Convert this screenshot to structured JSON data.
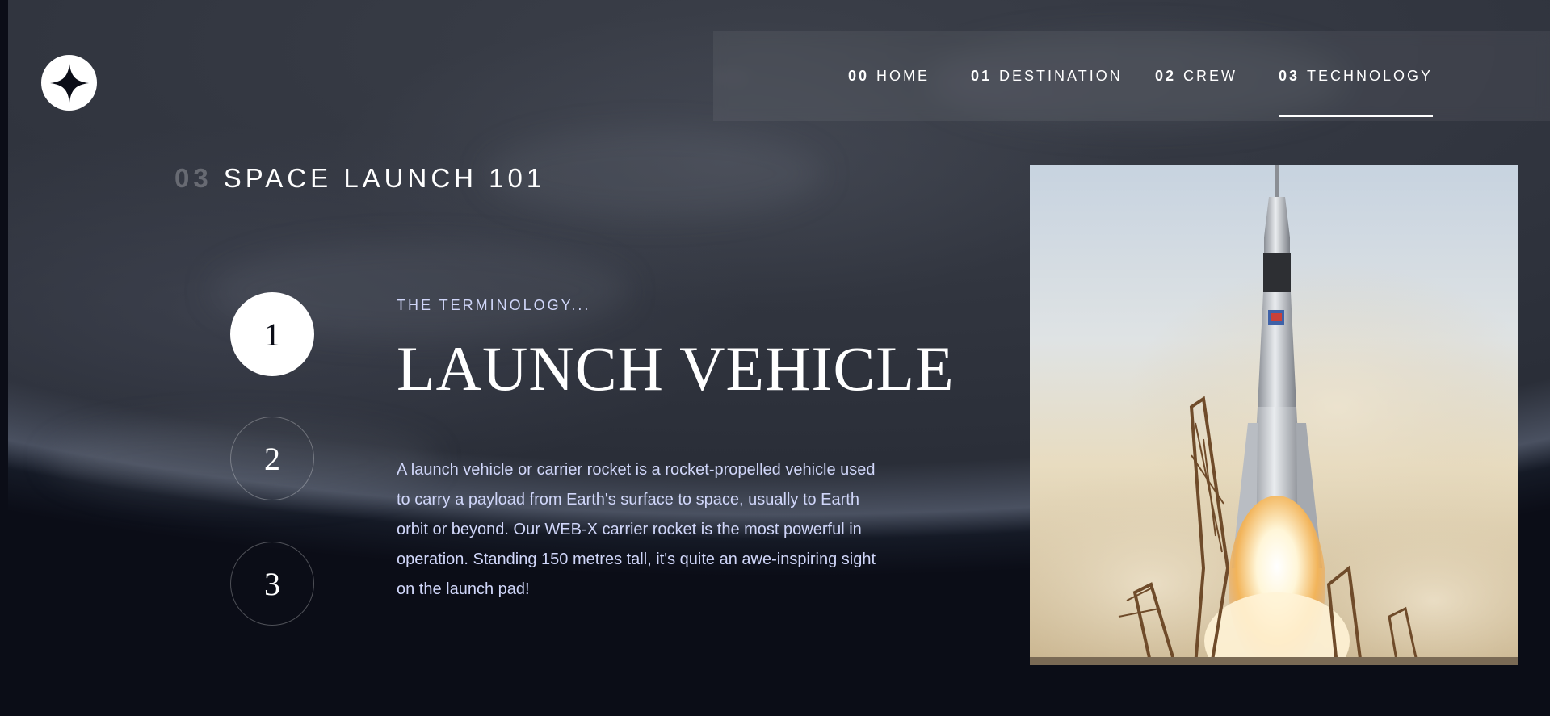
{
  "logo": {
    "icon": "star-logo-icon"
  },
  "nav": {
    "items": [
      {
        "num": "00",
        "label": "HOME",
        "active": false
      },
      {
        "num": "01",
        "label": "DESTINATION",
        "active": false
      },
      {
        "num": "02",
        "label": "CREW",
        "active": false
      },
      {
        "num": "03",
        "label": "TECHNOLOGY",
        "active": true
      }
    ]
  },
  "heading": {
    "num": "03",
    "text": "SPACE LAUNCH 101"
  },
  "steps": [
    {
      "label": "1",
      "active": true
    },
    {
      "label": "2",
      "active": false
    },
    {
      "label": "3",
      "active": false
    }
  ],
  "content": {
    "eyebrow": "THE TERMINOLOGY...",
    "title": "LAUNCH VEHICLE",
    "description": "A launch vehicle or carrier rocket is a rocket-propelled vehicle used to carry a payload from Earth's surface to space, usually to Earth orbit or beyond. Our WEB-X carrier rocket is the most powerful in operation. Standing 150 metres tall, it's quite an awe-inspiring sight on the launch pad!"
  },
  "image": {
    "subject": "rocket-launch-photo"
  },
  "colors": {
    "background": "#0b0d17",
    "text_light": "#d0d6f9",
    "white": "#ffffff"
  }
}
